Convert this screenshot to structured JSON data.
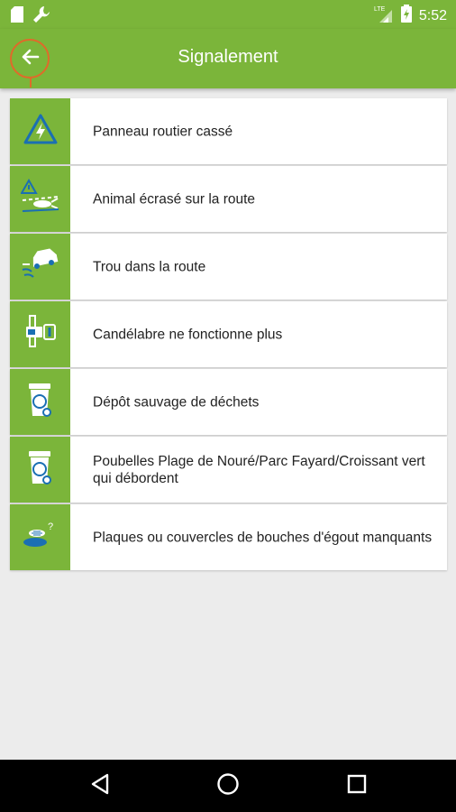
{
  "status_bar": {
    "time": "5:52",
    "network": "LTE",
    "icons": [
      "sim-card-icon",
      "wrench-icon",
      "signal-icon",
      "battery-icon"
    ]
  },
  "app_bar": {
    "title": "Signalement",
    "back_icon": "arrow-back-icon"
  },
  "items": [
    {
      "label": "Panneau routier cassé",
      "icon": "road-sign-warning-icon"
    },
    {
      "label": "Animal écrasé sur la route",
      "icon": "road-animal-icon"
    },
    {
      "label": "Trou dans la route",
      "icon": "car-pothole-icon"
    },
    {
      "label": "Candélabre ne fonctionne plus",
      "icon": "street-lamp-icon"
    },
    {
      "label": "Dépôt sauvage de déchets",
      "icon": "trash-bin-icon"
    },
    {
      "label": "Poubelles Plage de Nouré/Parc Fayard/Croissant vert qui débordent",
      "icon": "trash-bin-icon"
    },
    {
      "label": "Plaques ou couvercles de bouches d'égout manquants",
      "icon": "manhole-icon"
    }
  ],
  "nav_bar": {
    "buttons": [
      "back-triangle-icon",
      "home-circle-icon",
      "recents-square-icon"
    ]
  },
  "colors": {
    "primary": "#7bb53a",
    "accent": "#e06a2a",
    "icon_blue": "#1a6fb3",
    "background": "#ececec"
  }
}
